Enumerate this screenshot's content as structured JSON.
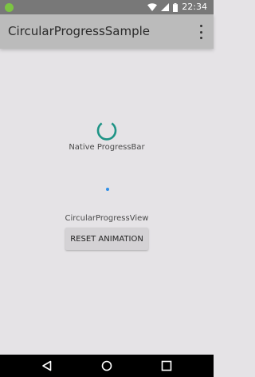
{
  "status_bar": {
    "time": "22:34",
    "icons": [
      "android-icon",
      "wifi-icon",
      "signal-icon",
      "battery-icon"
    ]
  },
  "app_bar": {
    "title": "CircularProgressSample",
    "menu_icon": "overflow-menu-icon"
  },
  "native_progress": {
    "label": "Native ProgressBar",
    "color": "#1f9486"
  },
  "circular_progress": {
    "label": "CircularProgressView",
    "color": "#2f8fe8"
  },
  "reset_button": {
    "label": "RESET ANIMATION"
  },
  "nav_bar": {
    "icons": [
      "back-icon",
      "home-icon",
      "recents-icon"
    ]
  }
}
